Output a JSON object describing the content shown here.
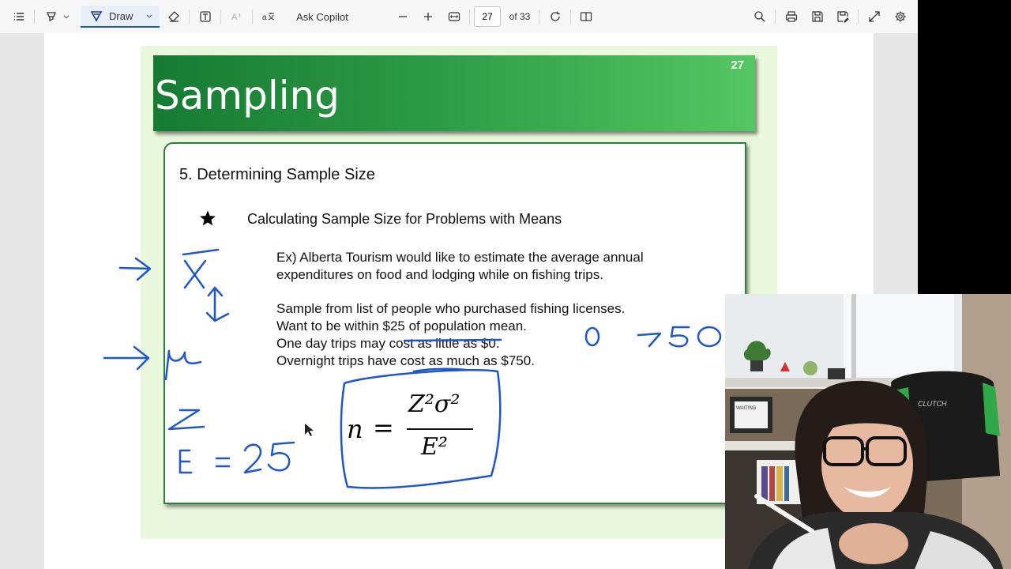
{
  "toolbar": {
    "draw_label": "Draw",
    "ask_copilot_label": "Ask Copilot",
    "page_number": "27",
    "page_total": "of 33"
  },
  "slide": {
    "title": "Sampling",
    "number": "27",
    "section_heading": "5. Determining Sample Size",
    "bullet_heading": "Calculating Sample Size for Problems with Means",
    "example_line1": "Ex) Alberta Tourism would like to estimate the average annual",
    "example_line2": "expenditures on food and lodging while on fishing trips.",
    "info_line1": "Sample from list of people who purchased fishing licenses.",
    "info_line2": "Want to be within $25 of population mean.",
    "info_line3": "One day trips may cost as little as $0.",
    "info_line4": "Overnight trips have cost as much as $750.",
    "formula_n": "n",
    "formula_eq": "=",
    "formula_numerator": "Z²σ²",
    "formula_denominator": "E²"
  },
  "annotations": {
    "xbar": "X",
    "mu": "μ",
    "z": "z",
    "e_value": "E = 25",
    "range_low": "0",
    "range_high": "750"
  },
  "webcam": {
    "chair_brand": "CLUTCH",
    "frame_text": "WAITING"
  },
  "colors": {
    "title_bar_start": "#167a33",
    "title_bar_end": "#55c662",
    "slide_background": "#e9f8dc",
    "ink_blue": "#1f57c8",
    "accent_blue": "#1f5aa6"
  }
}
